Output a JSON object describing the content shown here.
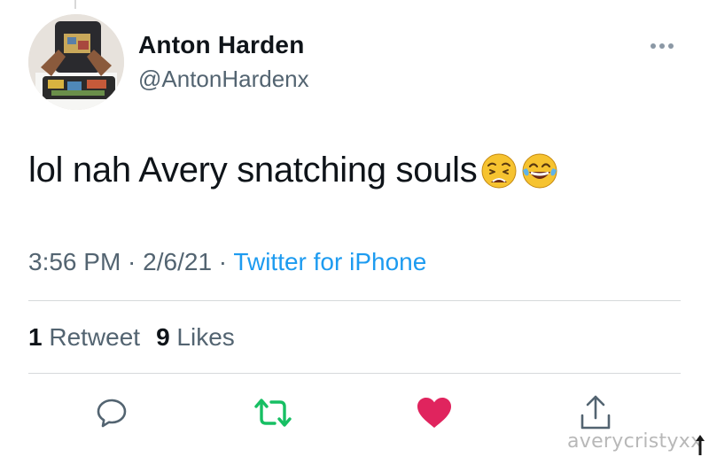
{
  "author": {
    "display_name": "Anton Harden",
    "handle": "@AntonHardenx"
  },
  "tweet": {
    "text": "lol nah Avery snatching souls",
    "emojis": [
      "weary-face-emoji",
      "tears-of-joy-emoji"
    ]
  },
  "meta": {
    "time": "3:56 PM",
    "sep1": " · ",
    "date": "2/6/21",
    "sep2": " · ",
    "source": "Twitter for iPhone"
  },
  "stats": {
    "retweets_count": "1",
    "retweets_label": " Retweet",
    "likes_count": "9",
    "likes_label": " Likes"
  },
  "actions": {
    "reply_icon": "reply-icon",
    "retweet_icon": "retweet-icon",
    "like_icon": "heart-icon",
    "share_icon": "share-icon"
  },
  "colors": {
    "retweet": "#17bf63",
    "like": "#e0245e",
    "source_link": "#1d9bf0",
    "secondary_text": "#536471"
  },
  "watermark": "averycristyxx"
}
